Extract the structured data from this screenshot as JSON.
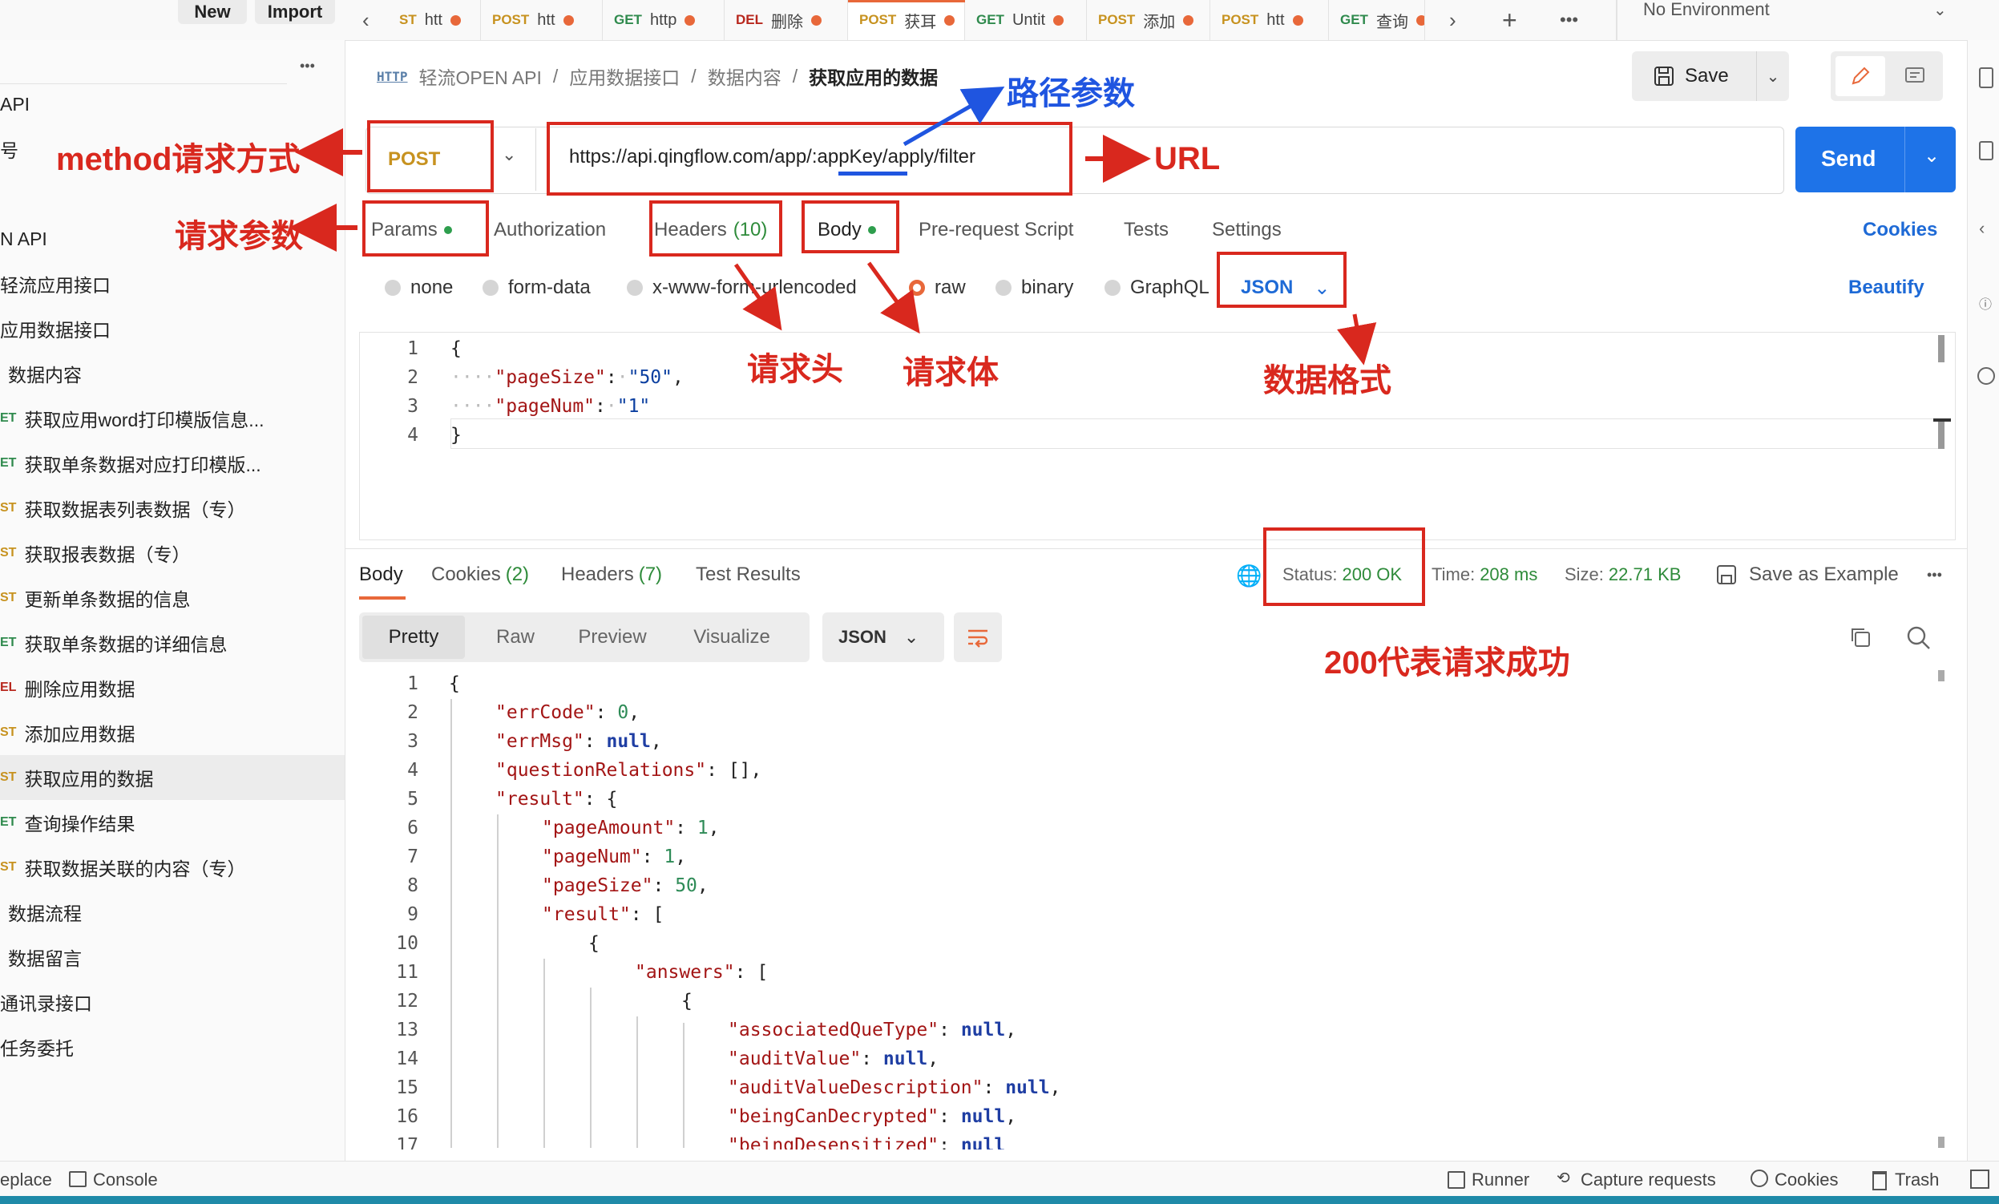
{
  "topbar": {
    "new_label": "New",
    "import_label": "Import",
    "tabs": [
      {
        "method": "ST",
        "label": "htt",
        "cls": "m-post"
      },
      {
        "method": "POST",
        "label": "htt",
        "cls": "m-post"
      },
      {
        "method": "GET",
        "label": "http",
        "cls": "m-get"
      },
      {
        "method": "DEL",
        "label": "删除",
        "cls": "m-del"
      },
      {
        "method": "POST",
        "label": "获耳",
        "cls": "m-post"
      },
      {
        "method": "GET",
        "label": "Untit",
        "cls": "m-get"
      },
      {
        "method": "POST",
        "label": "添加",
        "cls": "m-post"
      },
      {
        "method": "POST",
        "label": "htt",
        "cls": "m-post"
      },
      {
        "method": "GET",
        "label": "查询",
        "cls": "m-get"
      }
    ],
    "environment": "No Environment"
  },
  "sidebar": {
    "items": [
      {
        "method": "",
        "label": "API"
      },
      {
        "method": "",
        "label": "号"
      },
      {
        "method": "",
        "label": ""
      },
      {
        "method": "",
        "label": "N API"
      },
      {
        "method": "",
        "label": "轻流应用接口"
      },
      {
        "method": "",
        "label": "应用数据接口"
      },
      {
        "method": "",
        "label": "数据内容"
      },
      {
        "method": "ET",
        "label": "获取应用word打印模版信息..."
      },
      {
        "method": "ET",
        "label": "获取单条数据对应打印模版..."
      },
      {
        "method": "ST",
        "label": "获取数据表列表数据（专）"
      },
      {
        "method": "ST",
        "label": "获取报表数据（专）"
      },
      {
        "method": "ST",
        "label": "更新单条数据的信息"
      },
      {
        "method": "ET",
        "label": "获取单条数据的详细信息"
      },
      {
        "method": "EL",
        "label": "删除应用数据"
      },
      {
        "method": "ST",
        "label": "添加应用数据"
      },
      {
        "method": "ST",
        "label": "获取应用的数据"
      },
      {
        "method": "ET",
        "label": "查询操作结果"
      },
      {
        "method": "ST",
        "label": "获取数据关联的内容（专）"
      },
      {
        "method": "",
        "label": "数据流程"
      },
      {
        "method": "",
        "label": "数据留言"
      },
      {
        "method": "",
        "label": "通讯录接口"
      },
      {
        "method": "",
        "label": "任务委托"
      }
    ]
  },
  "breadcrumb": {
    "icon_text": "HTTP",
    "parts": [
      "轻流OPEN API",
      "应用数据接口",
      "数据内容"
    ],
    "current": "获取应用的数据"
  },
  "request": {
    "save_label": "Save",
    "method": "POST",
    "url_before": "https://api.qingflow.com/app/:",
    "url_param": "appKey",
    "url_after": "/apply/filter",
    "send_label": "Send",
    "tabs": {
      "params": "Params",
      "authorization": "Authorization",
      "headers": "Headers",
      "headers_count": "(10)",
      "body": "Body",
      "prerequest": "Pre-request Script",
      "tests": "Tests",
      "settings": "Settings",
      "cookies": "Cookies"
    },
    "body_types": [
      "none",
      "form-data",
      "x-www-form-urlencoded",
      "raw",
      "binary",
      "GraphQL"
    ],
    "body_format": "JSON",
    "beautify_label": "Beautify",
    "body_lines": [
      "1",
      "2",
      "3",
      "4"
    ],
    "body_code": {
      "l1": "{",
      "l2_key": "\"pageSize\"",
      "l2_val": "\"50\"",
      "l3_key": "\"pageNum\"",
      "l3_val": "\"1\"",
      "l4": "}"
    }
  },
  "annotations": {
    "method": "method请求方式",
    "params": "请求参数",
    "path_params": "路径参数",
    "url": "URL",
    "headers": "请求头",
    "body": "请求体",
    "format": "数据格式",
    "success": "200代表请求成功"
  },
  "response": {
    "tabs": {
      "body": "Body",
      "cookies": "Cookies",
      "cookies_count": "(2)",
      "headers": "Headers",
      "headers_count": "(7)",
      "test_results": "Test Results"
    },
    "status_label": "Status:",
    "status_value": "200 OK",
    "time_label": "Time:",
    "time_value": "208 ms",
    "size_label": "Size:",
    "size_value": "22.71 KB",
    "save_example": "Save as Example",
    "view_modes": [
      "Pretty",
      "Raw",
      "Preview",
      "Visualize"
    ],
    "format": "JSON",
    "lines": [
      "1",
      "2",
      "3",
      "4",
      "5",
      "6",
      "7",
      "8",
      "9",
      "10",
      "11",
      "12",
      "13",
      "14",
      "15",
      "16",
      "17"
    ],
    "code": {
      "errCode_k": "\"errCode\"",
      "errCode_v": "0",
      "errMsg_k": "\"errMsg\"",
      "errMsg_v": "null",
      "qr_k": "\"questionRelations\"",
      "qr_v": "[]",
      "result_k": "\"result\"",
      "pageAmount_k": "\"pageAmount\"",
      "pageAmount_v": "1",
      "pageNum_k": "\"pageNum\"",
      "pageNum_v": "1",
      "pageSize_k": "\"pageSize\"",
      "pageSize_v": "50",
      "result2_k": "\"result\"",
      "answers_k": "\"answers\"",
      "aqt_k": "\"associatedQueType\"",
      "aqt_v": "null",
      "av_k": "\"auditValue\"",
      "av_v": "null",
      "avd_k": "\"auditValueDescription\"",
      "avd_v": "null",
      "bcd_k": "\"beingCanDecrypted\"",
      "bcd_v": "null",
      "bd_k": "\"beingDesensitized\"",
      "bd_v": "null"
    }
  },
  "bottombar": {
    "replace": "eplace",
    "console": "Console",
    "runner": "Runner",
    "capture": "Capture requests",
    "cookies": "Cookies",
    "trash": "Trash"
  }
}
